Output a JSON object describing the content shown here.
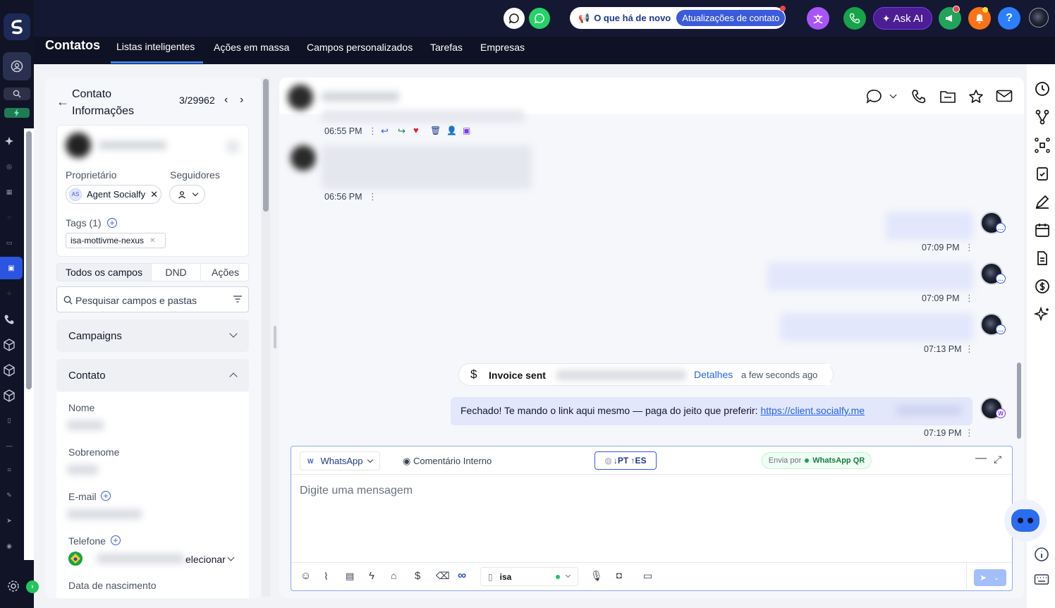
{
  "topbar": {
    "whats_new": "O que há de novo",
    "updates": "Atualizações de contato",
    "ask_ai": "Ask AI",
    "help": "?"
  },
  "nav": {
    "title": "Contatos",
    "tabs": [
      {
        "label": "Listas inteligentes"
      },
      {
        "label": "Ações em massa"
      },
      {
        "label": "Campos personalizados"
      },
      {
        "label": "Tarefas"
      },
      {
        "label": "Empresas"
      }
    ],
    "active_tab": "Listas inteligentes"
  },
  "contact_panel": {
    "title_line1": "Contato",
    "title_line2": "Informações",
    "counter": "3/29962",
    "owner_label": "Proprietário",
    "followers_label": "Seguidores",
    "owner_initials": "AS",
    "owner_name": "Agent Socialfy",
    "tags_label": "Tags (1)",
    "tag": "isa-mottivme-nexus",
    "subtabs": [
      "Todos os campos",
      "DND",
      "Ações"
    ],
    "search_placeholder": "Pesquisar campos e pastas",
    "sections": [
      "Campaigns",
      "Contato"
    ],
    "fields": {
      "first_name": "Nome",
      "last_name": "Sobrenome",
      "email": "E-mail",
      "phone": "Telefone",
      "phone_select": "elecionar",
      "birthdate": "Data de nascimento"
    }
  },
  "messages": [
    {
      "time": "06:55 PM"
    },
    {
      "time": "06:56 PM"
    },
    {
      "time": "07:09 PM"
    },
    {
      "time": "07:09 PM"
    },
    {
      "time": "07:13 PM"
    },
    {
      "time": "07:19 PM",
      "text": "Fechado! Te mando o link aqui mesmo — paga do jeito que preferir: ",
      "link": "https://client.socialfy.me"
    }
  ],
  "invoice": {
    "label": "Invoice sent",
    "details": "Detalhes",
    "ago": "a few seconds ago"
  },
  "composer": {
    "channel": "WhatsApp",
    "channel_badge": "W",
    "internal_comment": "Comentário Interno",
    "translate": "↓PT ↑ES",
    "send_via_prefix": "Envia por",
    "send_via": "WhatsApp QR",
    "placeholder": "Digite uma mensagem",
    "sender": "isa"
  },
  "colors": {
    "accent": "#3b5bdb",
    "rail": "#101426",
    "topbar": "#141833",
    "whatsapp": "#25d366",
    "notification": "#f97316"
  }
}
